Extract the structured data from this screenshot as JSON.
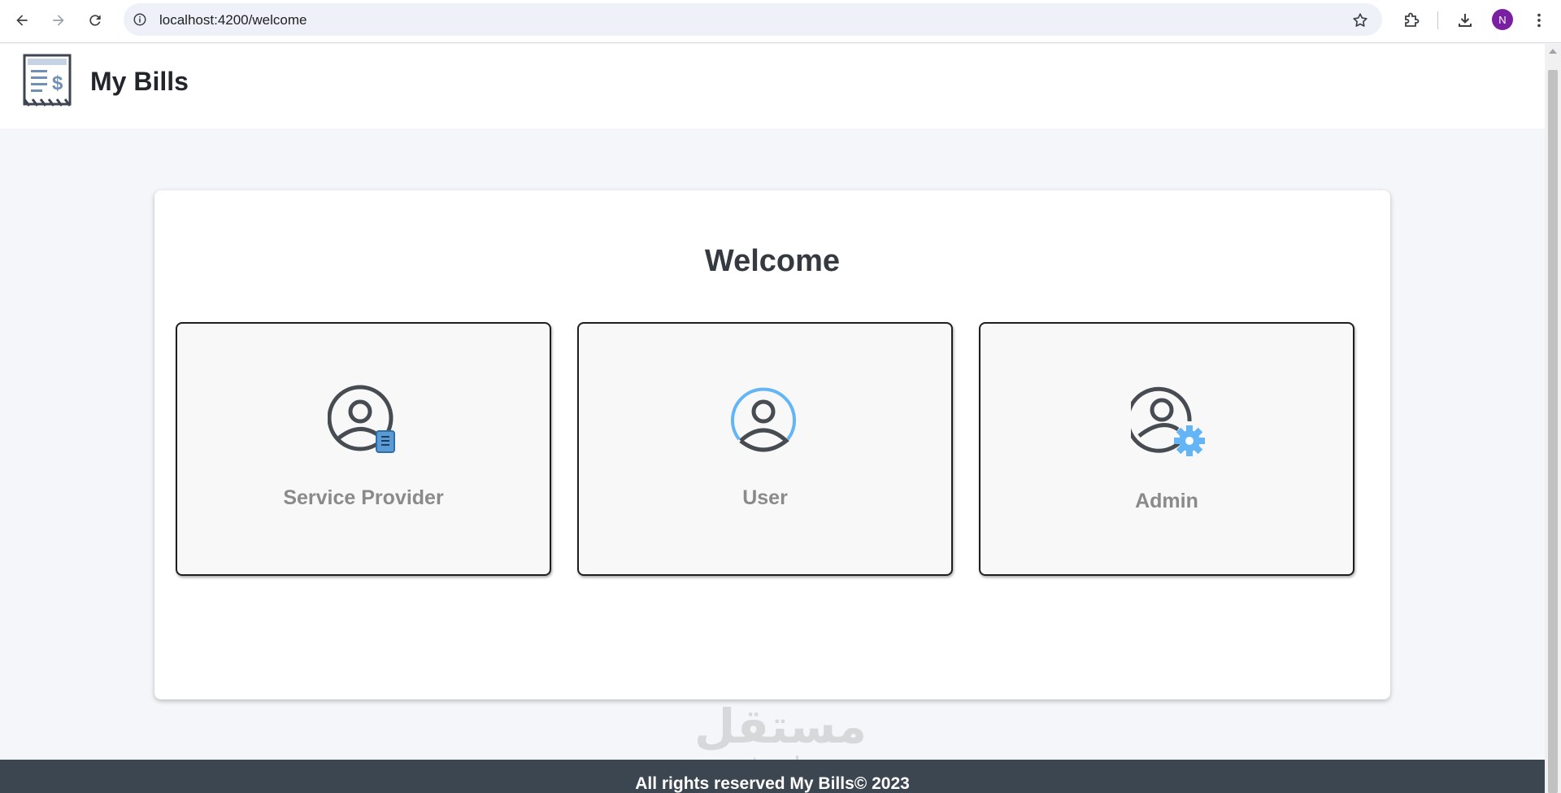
{
  "browser": {
    "url": "localhost:4200/welcome",
    "profile_initial": "N",
    "profile_color": "#7b1fa2"
  },
  "app": {
    "title": "My Bills",
    "logo_icon": "bill-receipt-icon"
  },
  "welcome": {
    "title": "Welcome",
    "roles": [
      {
        "label": "Service Provider",
        "icon": "service-provider-user-icon"
      },
      {
        "label": "User",
        "icon": "user-icon"
      },
      {
        "label": "Admin",
        "icon": "admin-user-gear-icon"
      }
    ]
  },
  "watermark": {
    "arabic": "مستقل",
    "latin": "mostaql.com"
  },
  "footer": {
    "text": "All rights reserved My Bills© 2023"
  },
  "colors": {
    "footer_bg": "#3c4651",
    "accent_blue": "#64b5f6",
    "page_bg": "#f5f6f9"
  }
}
